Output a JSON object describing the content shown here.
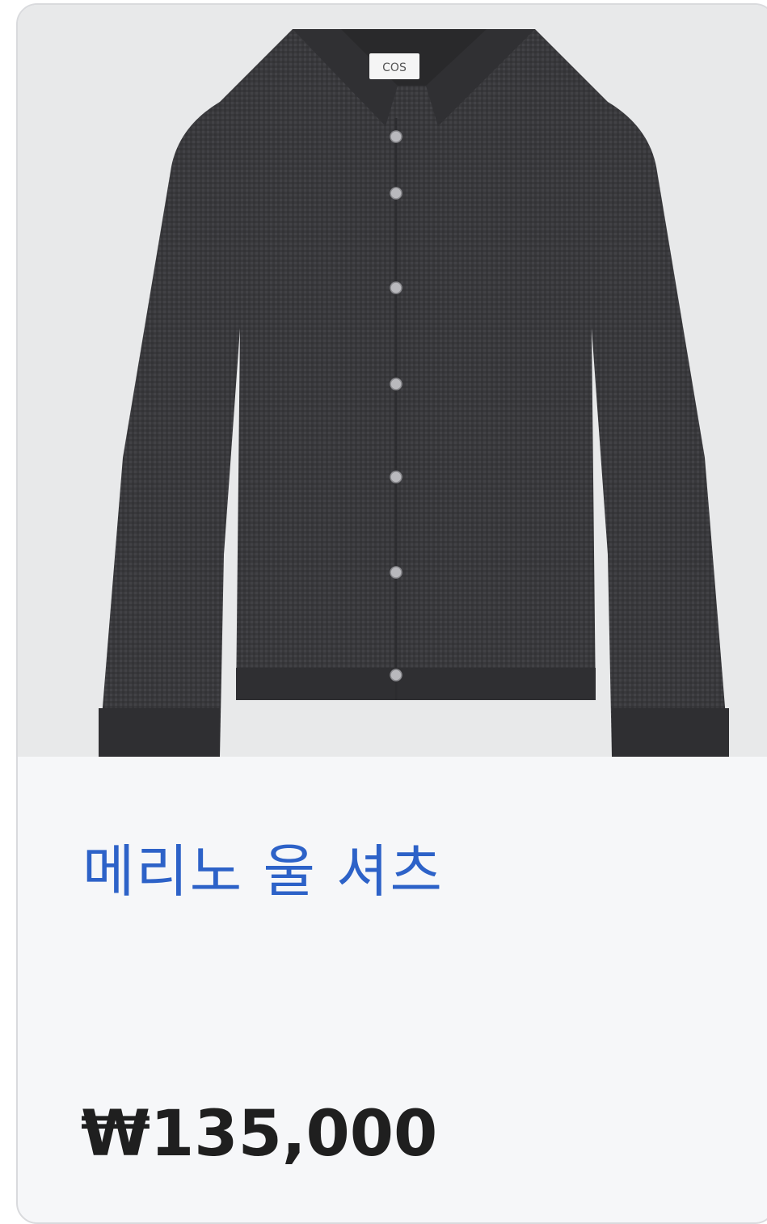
{
  "product": {
    "image_alt": "merino-wool-shirt-image",
    "label_text": "COS",
    "title": "메리노 울 셔츠",
    "price": "₩135,000"
  },
  "colors": {
    "title": "#2d62c8",
    "price": "#1f1f1f",
    "card_bg": "#f6f7f9",
    "garment": "#3a3a3d"
  }
}
